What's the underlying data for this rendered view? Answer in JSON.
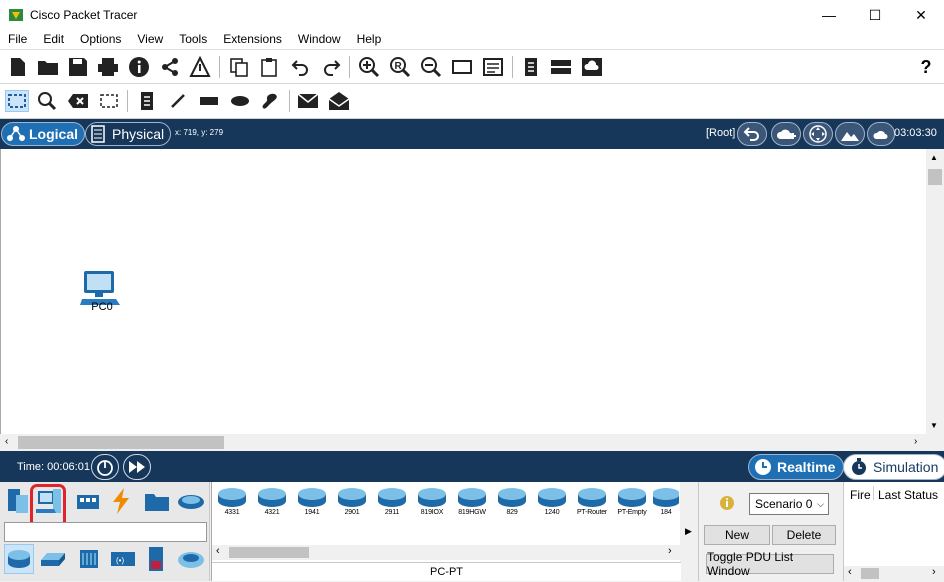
{
  "window": {
    "title": "Cisco Packet Tracer",
    "minimize": "—",
    "maximize": "☐",
    "close": "✕"
  },
  "menu": [
    "File",
    "Edit",
    "Options",
    "View",
    "Tools",
    "Extensions",
    "Window",
    "Help"
  ],
  "toolbar_main": {
    "icons": [
      "new-file-icon",
      "open-folder-icon",
      "save-icon",
      "print-icon",
      "info-icon",
      "network-info-icon",
      "activity-wizard-icon",
      "copy-icon",
      "paste-icon",
      "undo-icon",
      "redo-icon",
      "zoom-in-icon",
      "zoom-reset-icon",
      "zoom-out-icon",
      "palette-icon",
      "custom-device-dialog-icon",
      "notes-icon",
      "server-icon",
      "cloud-image-icon"
    ],
    "help": "?"
  },
  "toolbar_tools": {
    "icons": [
      "select-icon",
      "inspect-icon",
      "delete-icon",
      "resize-shape-icon",
      "place-note-icon",
      "draw-line-icon",
      "draw-rectangle-icon",
      "draw-ellipse-icon",
      "freeform-icon",
      "simple-pdu-icon",
      "complex-pdu-icon"
    ]
  },
  "nav": {
    "logical": "Logical",
    "physical": "Physical",
    "coords": "x: 719, y: 279",
    "root": "[Root]",
    "clock": "03:03:30"
  },
  "workspace": {
    "device_label": "PC0"
  },
  "timebar": {
    "time": "Time: 00:06:01",
    "realtime": "Realtime",
    "simulation": "Simulation"
  },
  "device_models": [
    "4331",
    "4321",
    "1941",
    "2901",
    "2911",
    "819IOX",
    "819HGW",
    "829",
    "1240",
    "PT-Router",
    "PT-Empty",
    "184"
  ],
  "selected_device_type": "PC-PT",
  "scenario": {
    "selected": "Scenario 0",
    "new_label": "New",
    "delete_label": "Delete",
    "toggle_label": "Toggle PDU List Window"
  },
  "pdu_list": {
    "col_fire": "Fire",
    "col_status": "Last Status"
  },
  "colors": {
    "navbar": "#16375a",
    "active_mode": "#1f6fb4",
    "highlight": "#e0242b"
  }
}
